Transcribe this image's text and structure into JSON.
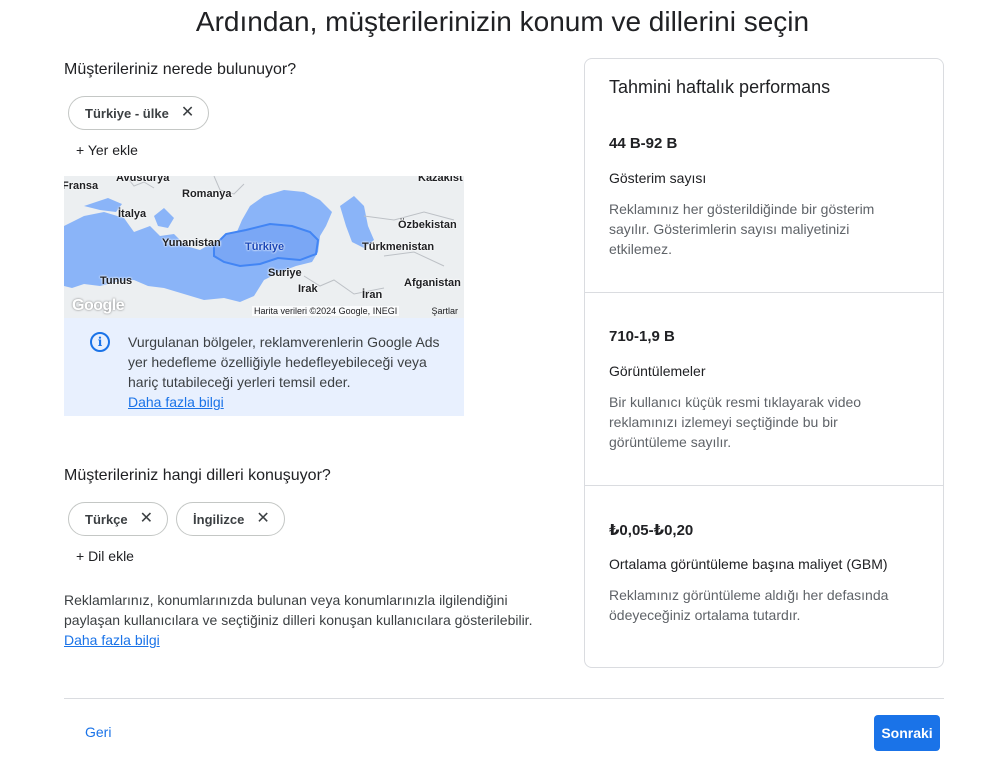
{
  "page": {
    "title": "Ardından, müşterilerinizin konum ve dillerini seçin"
  },
  "location": {
    "heading": "Müşterileriniz nerede bulunuyor?",
    "chips": [
      {
        "label": "Türkiye - ülke"
      }
    ],
    "add_label": "+ Yer ekle",
    "map": {
      "labels": {
        "fransa": "Fransa",
        "avusturya": "Avusturya",
        "kazakistan": "Kazakist",
        "romanya": "Romanya",
        "italya": "İtalya",
        "ozbekistan": "Özbekistan",
        "yunanistan": "Yunanistan",
        "turkiye": "Türkiye",
        "turkmenistan": "Türkmenistan",
        "suriye": "Suriye",
        "tunus": "Tunus",
        "irak": "Irak",
        "iran": "İran",
        "afganistan": "Afganistan"
      },
      "logo": "Google",
      "copyright": "Harita verileri ©2024 Google, INEGI",
      "terms": "Şartlar",
      "land_color": "#e8eaed",
      "highlight_color": "#8ab4f8",
      "border_color": "#4285f4"
    },
    "info": {
      "text": "Vurgulanan bölgeler, reklamverenlerin Google Ads yer hedefleme özelliğiyle hedefleyebileceği veya hariç tutabileceği yerleri temsil eder.",
      "link": "Daha fazla bilgi"
    }
  },
  "language": {
    "heading": "Müşterileriniz hangi dilleri konuşuyor?",
    "chips": [
      {
        "label": "Türkçe"
      },
      {
        "label": "İngilizce"
      }
    ],
    "add_label": "+ Dil ekle"
  },
  "disclaimer": {
    "text": "Reklamlarınız, konumlarınızda bulunan veya konumlarınızla ilgilendiğini paylaşan kullanıcılara ve seçtiğiniz dilleri konuşan kullanıcılara gösterilebilir.",
    "link": "Daha fazla bilgi"
  },
  "performance": {
    "title": "Tahmini haftalık performans",
    "metrics": [
      {
        "value": "44 B-92 B",
        "label": "Gösterim sayısı",
        "description": "Reklamınız her gösterildiğinde bir gösterim sayılır. Gösterimlerin sayısı maliyetinizi etkilemez."
      },
      {
        "value": "710-1,9 B",
        "label": "Görüntülemeler",
        "description": "Bir kullanıcı küçük resmi tıklayarak video reklamınızı izlemeyi seçtiğinde bu bir görüntüleme sayılır."
      },
      {
        "value": "₺0,05-₺0,20",
        "label": "Ortalama görüntüleme başına maliyet (GBM)",
        "description": "Reklamınız görüntüleme aldığı her defasında ödeyeceğiniz ortalama tutardır."
      }
    ]
  },
  "footer": {
    "back_label": "Geri",
    "next_label": "Sonraki"
  },
  "colors": {
    "accent": "#1a73e8",
    "info_bg": "#e8f0fe"
  }
}
